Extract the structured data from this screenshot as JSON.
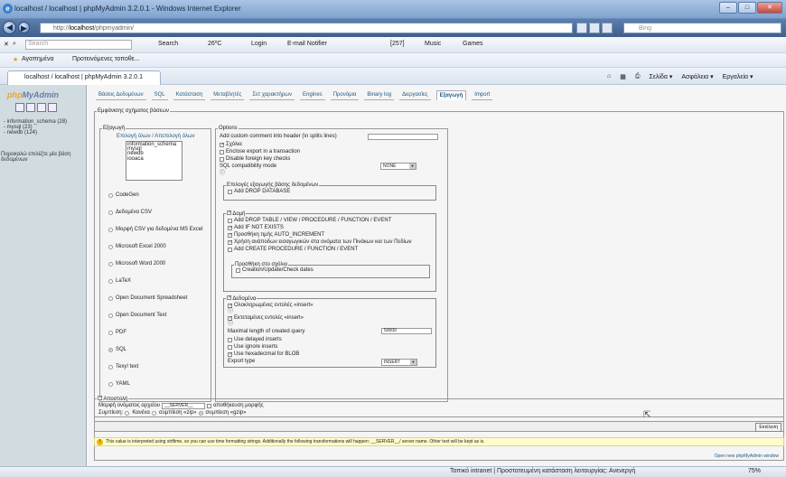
{
  "window": {
    "title": "localhost / localhost | phpMyAdmin 3.2.0.1 - Windows Internet Explorer"
  },
  "address": {
    "url_prefix": "http://",
    "url_host": "localhost",
    "url_path": "/phpmyadmin/",
    "bing": "Bing"
  },
  "toolbar": {
    "search_placeholder": "Search",
    "search_btn": "Search",
    "temp": "26ºC",
    "login": "Login",
    "email": "E-mail Notifier",
    "mail_count": "[257]",
    "music": "Music",
    "games": "Games"
  },
  "favbar": {
    "favorites": "Αγαπημένα",
    "suggested": "Προτεινόμενες τοποθε..."
  },
  "tab": {
    "label": "localhost / localhost | phpMyAdmin 3.2.0.1"
  },
  "cmdbar": {
    "page": "Σελίδα ▾",
    "safety": "Ασφάλεια ▾",
    "tools": "Εργαλεία ▾"
  },
  "left": {
    "logo_a": "php",
    "logo_b": "MyAdmin",
    "databases": [
      "- information_schema (28)",
      "- mysql (23)",
      "- newdb (124)"
    ],
    "hint": [
      "Παρακαλώ επιλέξτε μία βάση",
      "δεδομένων"
    ]
  },
  "tabs": [
    "Βάσεις Δεδομένων",
    "SQL",
    "Κατάσταση",
    "Μεταβλητές",
    "Σετ χαρακτήρων",
    "Engines",
    "Προνόμια",
    "Binary log",
    "Διεργασίες",
    "Εξαγωγή",
    "Import"
  ],
  "export": {
    "outer_legend": "Εμφάνισης σχήματος βάσεων",
    "legend": "Εξαγωγή",
    "select_all": "Επιλογή όλων / Απεπιλογή όλων",
    "dbs": [
      "information_schema",
      "mysql",
      "newdb",
      "iooaca"
    ],
    "formats": [
      "CodeGen",
      "Δεδομένα CSV",
      "Μορφή CSV για δεδομένα MS Excel",
      "Microsoft Excel 2000",
      "Microsoft Word 2000",
      "LaTeX",
      "Open Document Spreadsheet",
      "Open Document Text",
      "PDF",
      "SQL",
      "Texy! text",
      "YAML"
    ],
    "selected": "SQL"
  },
  "options": {
    "legend": "Options",
    "comment_label": "Add custom comment into header (\\n splits lines)",
    "comments": "Σχόλια",
    "enclose": "Enclose export in a transaction",
    "disable_fk": "Disable foreign key checks",
    "compat_label": "SQL compatibility mode",
    "compat_value": "NONE",
    "db_legend": "Επιλογές εξαγωγής βάσης δεδομένων",
    "add_drop_db": "Add DROP DATABASE",
    "struct_legend": "Δομή",
    "add_drop_table": "Add DROP TABLE / VIEW / PROCEDURE / FUNCTION / EVENT",
    "if_not_exists": "Add IF NOT EXISTS",
    "auto_inc": "Προσθήκη τιμής AUTO_INCREMENT",
    "backquotes": "Χρήση ανάποδων εισαγωγικών στα ονόματα των Πινάκων και των Πεδίων",
    "create_proc": "Add CREATE PROCEDURE / FUNCTION / EVENT",
    "comments_legend": "Προσθήκη στο σχόλιο",
    "dates": "Creation/Update/Check dates",
    "data_legend": "Δεδομένα",
    "complete_inserts": "Ολοκληρωμένες εντολές «insert»",
    "extended_inserts": "Εκτεταμένες εντολές «insert»",
    "max_len_label": "Maximal length of created query",
    "max_len_value": "50000",
    "delayed": "Use delayed inserts",
    "ignore": "Use ignore inserts",
    "hex": "Use hexadecimal for BLOB",
    "export_type_label": "Export type",
    "export_type_value": "INSERT"
  },
  "save": {
    "legend": "Αποστολή",
    "template_label": "Μορφή ονόματος αρχείου",
    "template_value": "__SERVER__",
    "remember": "αποθήκευση μορφής",
    "compression_label": "Συμπίεση:",
    "c_none": "Κανένα",
    "c_zip": "συμπίεση «zip»",
    "c_gzip": "συμπίεση «gzip»"
  },
  "go": "Εκτέλεση",
  "note": "This value is interpreted using strftime, so you can use time formatting strings. Additionally the following transformations will happen: __SERVER__/ server name. Other text will be kept as is.",
  "newwin": "Open new phpMyAdmin window",
  "status": {
    "zone": "Τοπικό intranet | Προστατευμένη κατάσταση λειτουργίας: Ανενεργή",
    "zoom": "75%"
  }
}
